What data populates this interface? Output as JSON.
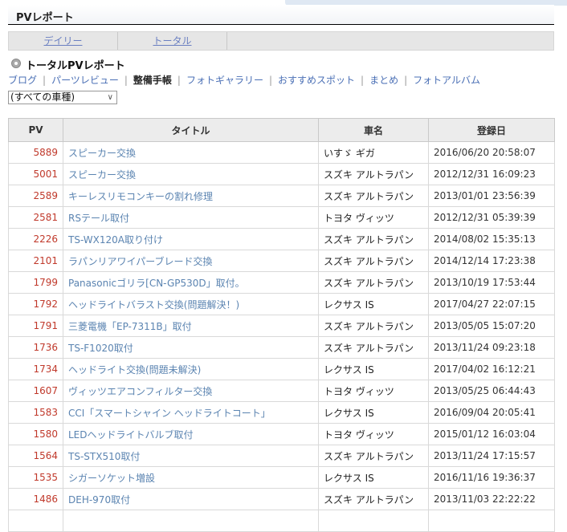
{
  "page": {
    "title": "PVレポート"
  },
  "tabs": [
    {
      "label": "デイリー"
    },
    {
      "label": "トータル"
    }
  ],
  "section": {
    "title": "トータルPVレポート"
  },
  "categories": [
    "ブログ",
    "パーツレビュー",
    "整備手帳",
    "フォトギャラリー",
    "おすすめスポット",
    "まとめ",
    "フォトアルバム"
  ],
  "active_category": "整備手帳",
  "filter": {
    "selected": "(すべての車種)"
  },
  "table": {
    "headers": {
      "pv": "PV",
      "title": "タイトル",
      "car": "車名",
      "date": "登録日"
    },
    "rows": [
      {
        "pv": "5889",
        "title": "スピーカー交換",
        "car": "いすゞ ギガ",
        "date": "2016/06/20 20:58:07"
      },
      {
        "pv": "5001",
        "title": "スピーカー交換",
        "car": "スズキ アルトラパン",
        "date": "2012/12/31 16:09:23"
      },
      {
        "pv": "2589",
        "title": "キーレスリモコンキーの割れ修理",
        "car": "スズキ アルトラパン",
        "date": "2013/01/01 23:56:39"
      },
      {
        "pv": "2581",
        "title": "RSテール取付",
        "car": "トヨタ ヴィッツ",
        "date": "2012/12/31 05:39:39"
      },
      {
        "pv": "2226",
        "title": "TS-WX120A取り付け",
        "car": "スズキ アルトラパン",
        "date": "2014/08/02 15:35:13"
      },
      {
        "pv": "2101",
        "title": "ラパンリアワイパーブレード交換",
        "car": "スズキ アルトラパン",
        "date": "2014/12/14 17:23:38"
      },
      {
        "pv": "1799",
        "title": "Panasonicゴリラ[CN-GP530D」取付。",
        "car": "スズキ アルトラパン",
        "date": "2013/10/19 17:53:44"
      },
      {
        "pv": "1792",
        "title": "ヘッドライトバラスト交換(問題解決！)",
        "car": "レクサス IS",
        "date": "2017/04/27 22:07:15"
      },
      {
        "pv": "1791",
        "title": "三菱電機「EP-7311B」取付",
        "car": "スズキ アルトラパン",
        "date": "2013/05/05 15:07:20"
      },
      {
        "pv": "1736",
        "title": "TS-F1020取付",
        "car": "スズキ アルトラパン",
        "date": "2013/11/24 09:23:18"
      },
      {
        "pv": "1734",
        "title": "ヘッドライト交換(問題未解決)",
        "car": "レクサス IS",
        "date": "2017/04/02 16:12:21"
      },
      {
        "pv": "1607",
        "title": "ヴィッツエアコンフィルター交換",
        "car": "トヨタ ヴィッツ",
        "date": "2013/05/25 06:44:43"
      },
      {
        "pv": "1583",
        "title": "CCI「スマートシャイン ヘッドライトコート」",
        "car": "レクサス IS",
        "date": "2016/09/04 20:05:41"
      },
      {
        "pv": "1580",
        "title": "LEDヘッドライトバルブ取付",
        "car": "トヨタ ヴィッツ",
        "date": "2015/01/12 16:03:04"
      },
      {
        "pv": "1564",
        "title": "TS-STX510取付",
        "car": "スズキ アルトラパン",
        "date": "2013/11/24 17:15:57"
      },
      {
        "pv": "1535",
        "title": "シガーソケット増設",
        "car": "レクサス IS",
        "date": "2016/11/16 19:36:37"
      },
      {
        "pv": "1486",
        "title": "DEH-970取付",
        "car": "スズキ アルトラパン",
        "date": "2013/11/03 22:22:22"
      },
      {
        "pv": "",
        "title": "",
        "car": "",
        "date": ""
      }
    ]
  },
  "colors": {
    "pv": "#c0392b",
    "link": "#5b84b1",
    "nav": "#4a6fb5"
  }
}
